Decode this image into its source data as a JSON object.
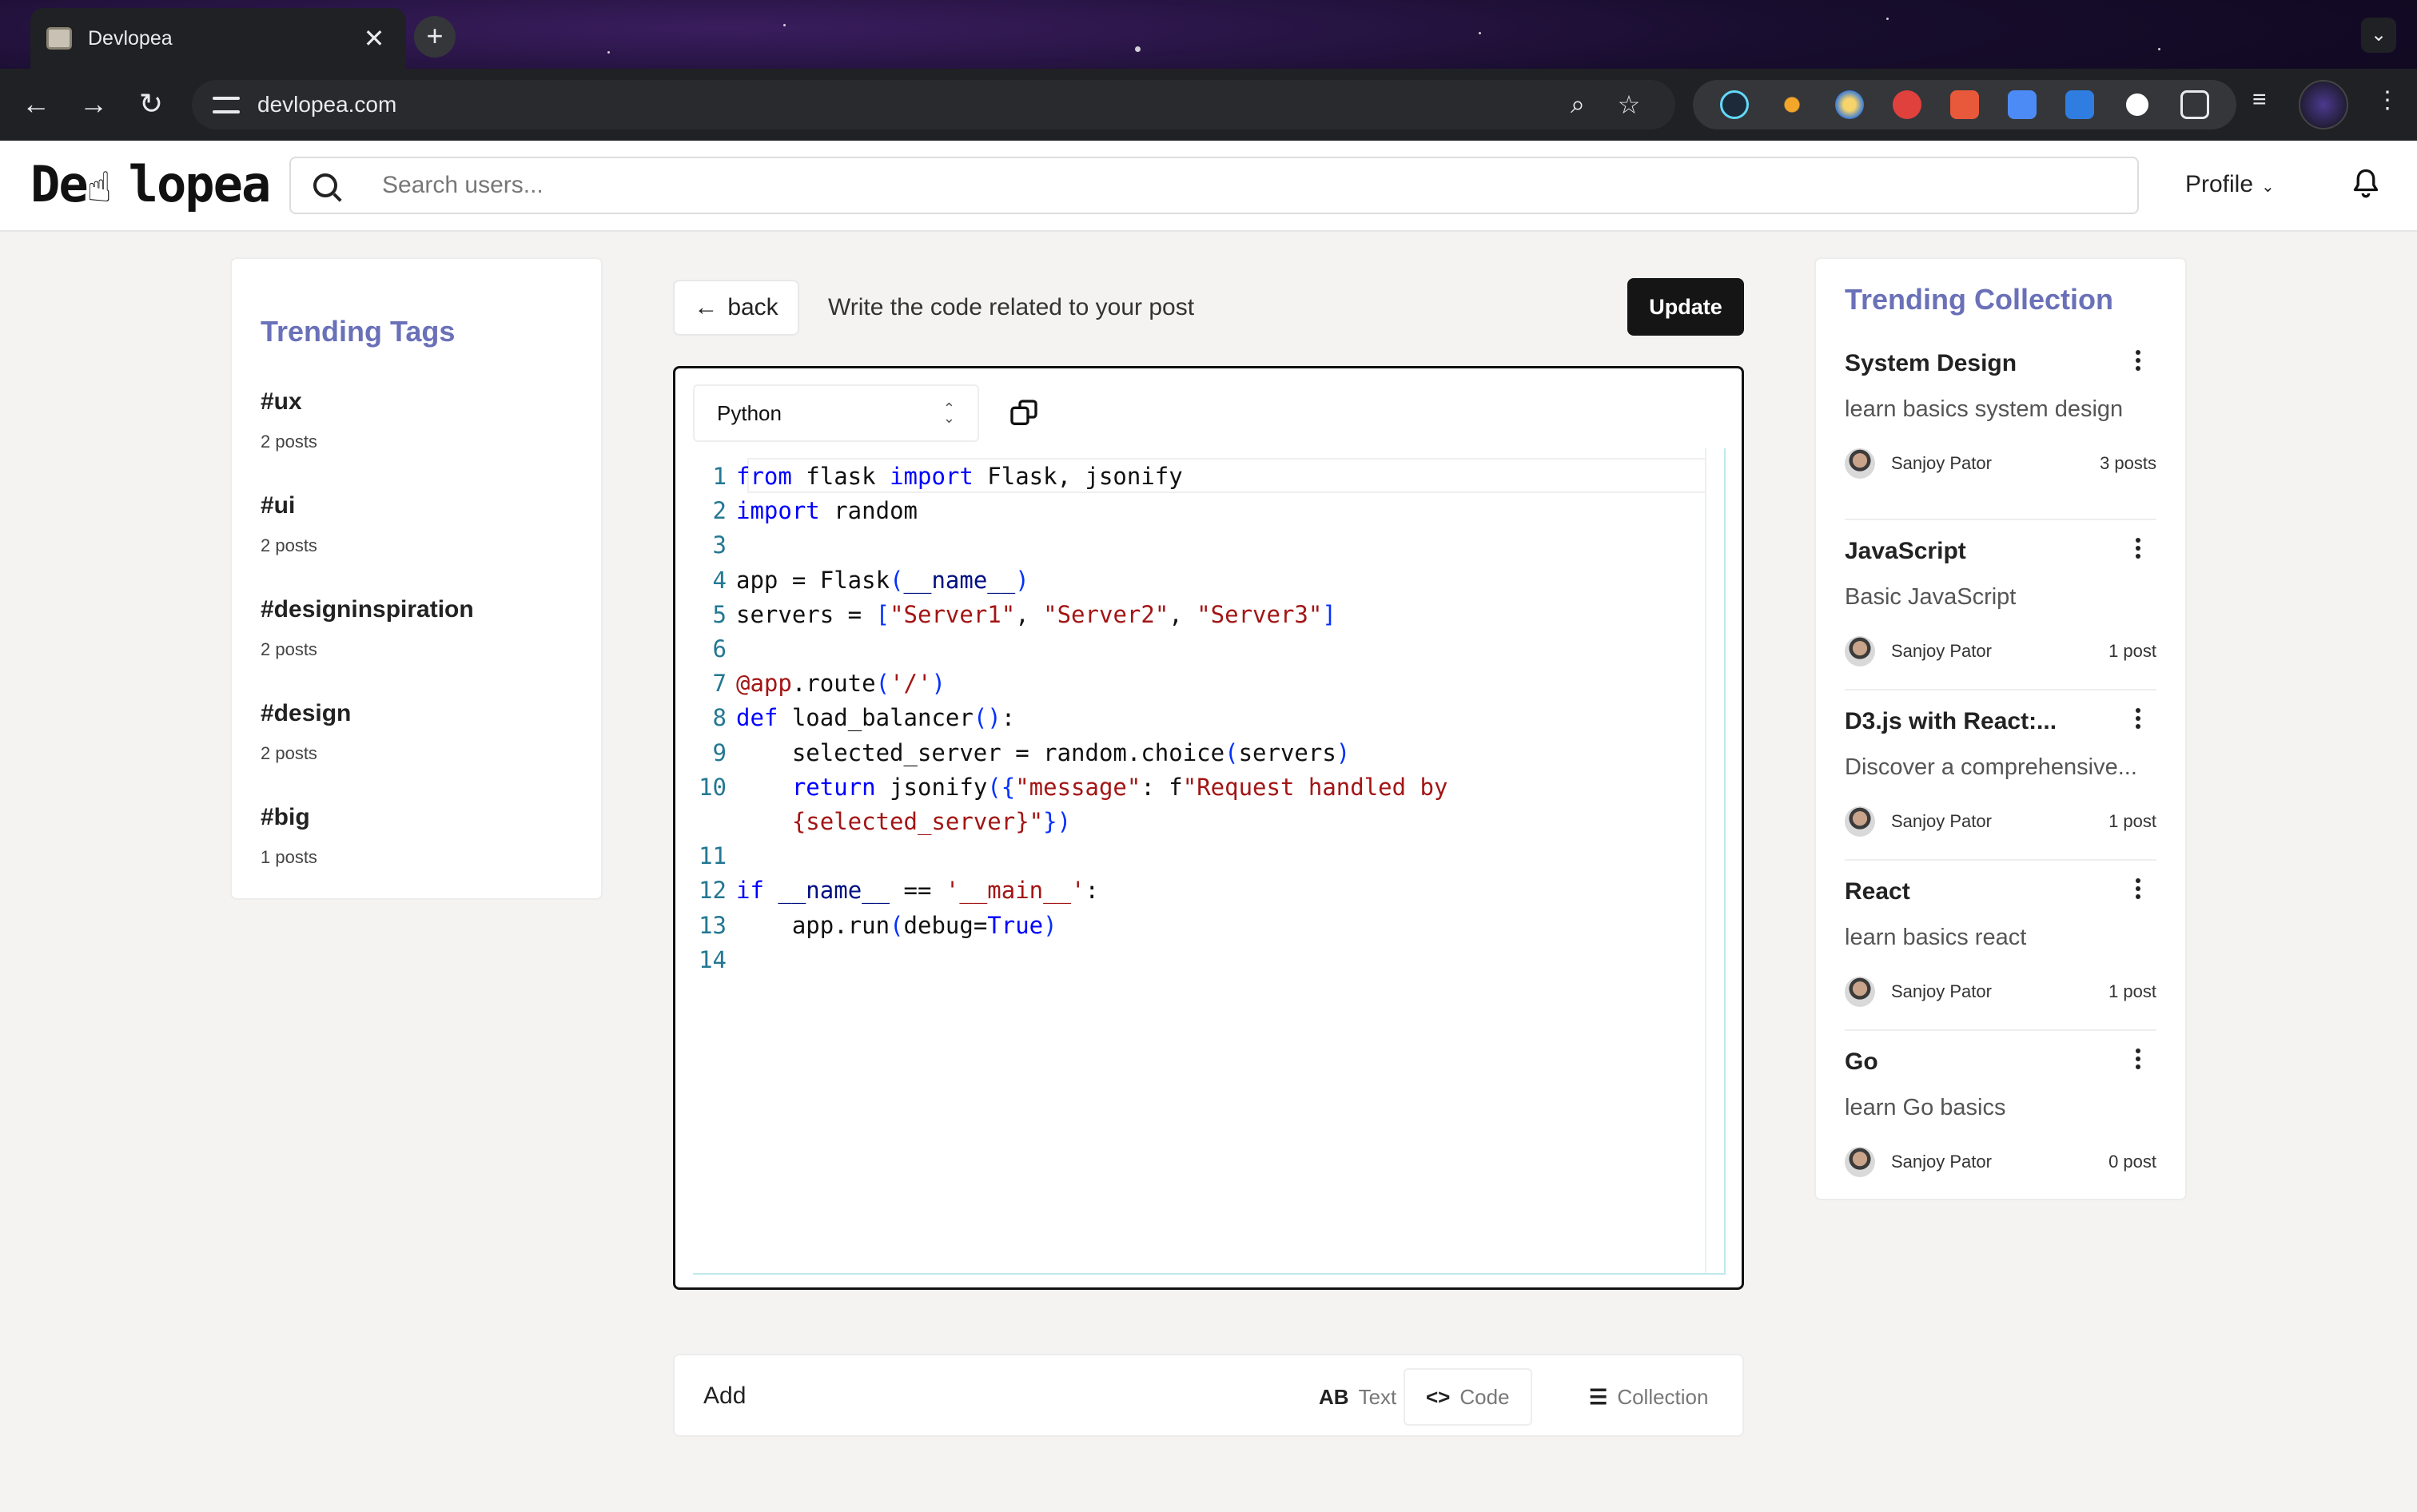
{
  "browser": {
    "tab_title": "Devlopea",
    "url": "devlopea.com"
  },
  "header": {
    "logo_text_start": "De",
    "logo_text_end": "lopea",
    "search_placeholder": "Search users...",
    "profile_label": "Profile"
  },
  "trending_tags": {
    "title": "Trending Tags",
    "items": [
      {
        "name": "#ux",
        "count": "2 posts"
      },
      {
        "name": "#ui",
        "count": "2 posts"
      },
      {
        "name": "#designinspiration",
        "count": "2 posts"
      },
      {
        "name": "#design",
        "count": "2 posts"
      },
      {
        "name": "#big",
        "count": "1 posts"
      }
    ]
  },
  "editor": {
    "back_label": "back",
    "instruction": "Write the code related to your post",
    "update_label": "Update",
    "language": "Python",
    "line_numbers": [
      "1",
      "2",
      "3",
      "4",
      "5",
      "6",
      "7",
      "8",
      "9",
      "10",
      "",
      "11",
      "12",
      "13",
      "14"
    ]
  },
  "add_bar": {
    "label": "Add",
    "text_label": "Text",
    "text_glyph": "AB",
    "code_label": "Code",
    "code_glyph": "<>",
    "collection_label": "Collection"
  },
  "trending_collection": {
    "title": "Trending Collection",
    "items": [
      {
        "name": "System Design",
        "desc": "learn basics system design",
        "author": "Sanjoy Pator",
        "posts": "3 posts"
      },
      {
        "name": "JavaScript",
        "desc": "Basic JavaScript",
        "author": "Sanjoy Pator",
        "posts": "1 post"
      },
      {
        "name": "D3.js with React:...",
        "desc": "Discover a comprehensive...",
        "author": "Sanjoy Pator",
        "posts": "1 post"
      },
      {
        "name": "React",
        "desc": "learn basics react",
        "author": "Sanjoy Pator",
        "posts": "1 post"
      },
      {
        "name": "Go",
        "desc": "learn Go basics",
        "author": "Sanjoy Pator",
        "posts": "0 post"
      }
    ]
  }
}
